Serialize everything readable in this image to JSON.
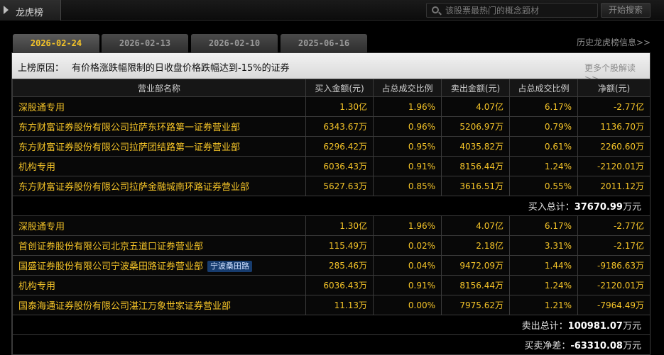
{
  "header": {
    "title": "龙虎榜",
    "search_placeholder": "该股票最热门的概念题材",
    "search_button": "开始搜索"
  },
  "tabs": [
    {
      "label": "2026-02-24",
      "active": true
    },
    {
      "label": "2026-02-13",
      "active": false
    },
    {
      "label": "2026-02-10",
      "active": false
    },
    {
      "label": "2025-06-16",
      "active": false
    }
  ],
  "history_link": "历史龙虎榜信息>>",
  "reason": {
    "label": "上榜原因：",
    "text": "有价格涨跌幅限制的日收盘价格跌幅达到-15%的证券",
    "more_link": "更多个股解读>>"
  },
  "columns": [
    "营业部名称",
    "买入金额(元)",
    "占总成交比例",
    "卖出金额(元)",
    "占总成交比例",
    "净额(元)"
  ],
  "buy_rows": [
    {
      "name": "深股通专用",
      "buy": "1.30亿",
      "buy_pct": "1.96%",
      "sell": "4.07亿",
      "sell_pct": "6.17%",
      "net": "-2.77亿"
    },
    {
      "name": "东方财富证券股份有限公司拉萨东环路第一证券营业部",
      "buy": "6343.67万",
      "buy_pct": "0.96%",
      "sell": "5206.97万",
      "sell_pct": "0.79%",
      "net": "1136.70万"
    },
    {
      "name": "东方财富证券股份有限公司拉萨团结路第一证券营业部",
      "buy": "6296.42万",
      "buy_pct": "0.95%",
      "sell": "4035.82万",
      "sell_pct": "0.61%",
      "net": "2260.60万"
    },
    {
      "name": "机构专用",
      "buy": "6036.43万",
      "buy_pct": "0.91%",
      "sell": "8156.44万",
      "sell_pct": "1.24%",
      "net": "-2120.01万"
    },
    {
      "name": "东方财富证券股份有限公司拉萨金融城南环路证券营业部",
      "buy": "5627.63万",
      "buy_pct": "0.85%",
      "sell": "3616.51万",
      "sell_pct": "0.55%",
      "net": "2011.12万"
    }
  ],
  "buy_total": {
    "label": "买入总计：",
    "value": "37670.99",
    "unit": "万元"
  },
  "sell_rows": [
    {
      "name": "深股通专用",
      "tag": "",
      "buy": "1.30亿",
      "buy_pct": "1.96%",
      "sell": "4.07亿",
      "sell_pct": "6.17%",
      "net": "-2.77亿"
    },
    {
      "name": "首创证券股份有限公司北京五道口证券营业部",
      "tag": "",
      "buy": "115.49万",
      "buy_pct": "0.02%",
      "sell": "2.18亿",
      "sell_pct": "3.31%",
      "net": "-2.17亿"
    },
    {
      "name": "国盛证券股份有限公司宁波桑田路证券营业部",
      "tag": "宁波桑田路",
      "buy": "285.46万",
      "buy_pct": "0.04%",
      "sell": "9472.09万",
      "sell_pct": "1.44%",
      "net": "-9186.63万"
    },
    {
      "name": "机构专用",
      "tag": "",
      "buy": "6036.43万",
      "buy_pct": "0.91%",
      "sell": "8156.44万",
      "sell_pct": "1.24%",
      "net": "-2120.01万"
    },
    {
      "name": "国泰海通证券股份有限公司湛江万象世家证券营业部",
      "tag": "",
      "buy": "11.13万",
      "buy_pct": "0.00%",
      "sell": "7975.62万",
      "sell_pct": "1.21%",
      "net": "-7964.49万"
    }
  ],
  "sell_total": {
    "label": "卖出总计：",
    "value": "100981.07",
    "unit": "万元"
  },
  "net_total": {
    "label": "买卖净差：",
    "value": "-63310.08",
    "unit": "万元"
  },
  "colors": {
    "accent": "#f5c428",
    "tag_bg": "#173c6e"
  }
}
